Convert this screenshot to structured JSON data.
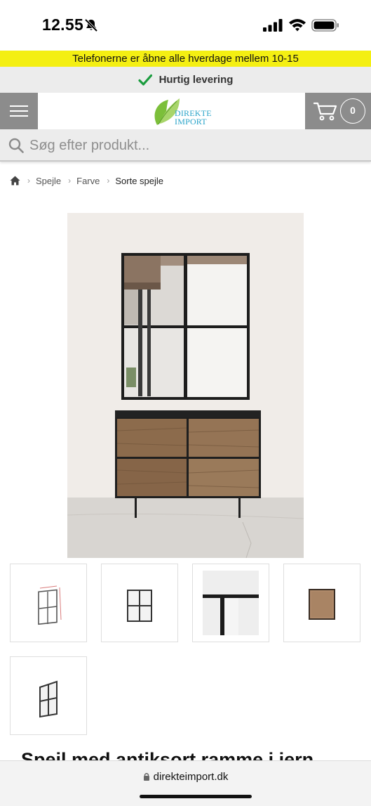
{
  "status_bar": {
    "time": "12.55",
    "icons": [
      "bell-slash-icon",
      "signal-icon",
      "wifi-icon",
      "battery-icon"
    ]
  },
  "announcement": {
    "text": "Telefonerne er åbne alle hverdage mellem 10-15",
    "background": "#f4ef12"
  },
  "delivery": {
    "icon": "check-icon",
    "text": "Hurtig levering",
    "check_color": "#1a9c3e"
  },
  "header": {
    "menu_icon": "hamburger-icon",
    "logo": {
      "line1": "DIREKTE",
      "line2": "IMPORT",
      "text_color": "#2aa4c9",
      "leaf_color": "#7cbf3a"
    },
    "cart": {
      "icon": "cart-icon",
      "count": "0"
    },
    "bar_color": "#8c8c8c"
  },
  "search": {
    "placeholder": "Søg efter produkt..."
  },
  "breadcrumb": {
    "home_icon": "home-icon",
    "items": [
      "Spejle",
      "Farve"
    ],
    "current": "Sorte spejle"
  },
  "product": {
    "title": "Spejl med antiksort ramme i jern",
    "main_image": "mirror-over-wooden-sideboard",
    "thumbnails": [
      "mirror-dimensions-thumb",
      "mirror-front-thumb",
      "mirror-side-thumb",
      "mirror-back-thumb",
      "mirror-angle-thumb"
    ]
  },
  "browser": {
    "url": "direkteimport.dk"
  }
}
